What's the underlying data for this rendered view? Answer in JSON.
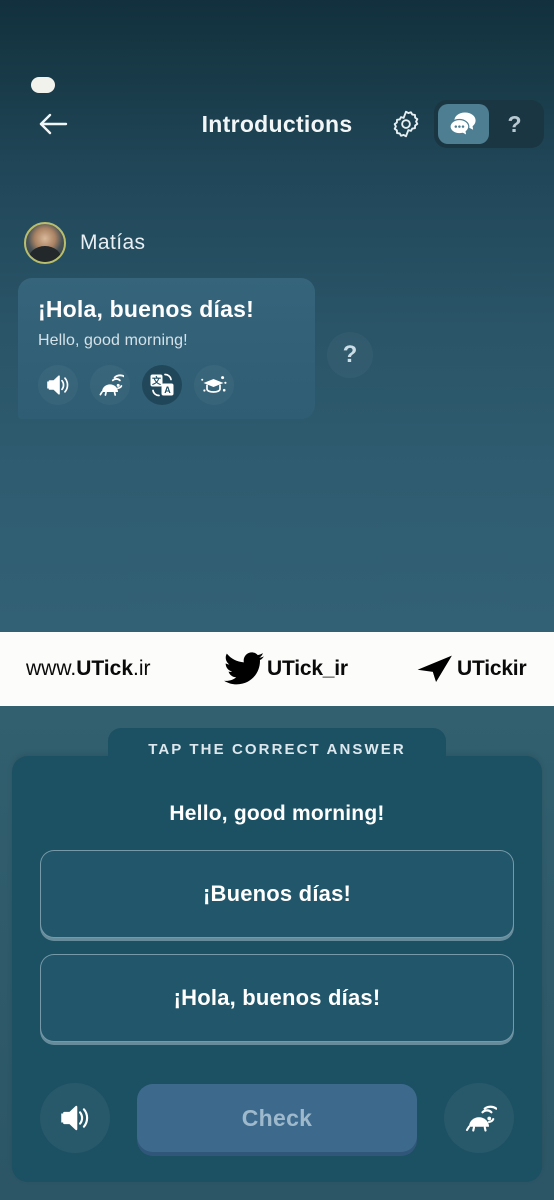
{
  "header": {
    "title": "Introductions",
    "back_icon": "back-arrow-icon",
    "gear_icon": "gear-icon",
    "toggle": {
      "chat_icon": "chat-bubbles-icon",
      "chat_active": true,
      "help_label": "?"
    }
  },
  "status_bar": {
    "pill": "status-pill"
  },
  "conversation": {
    "speaker": {
      "name": "Matías",
      "avatar_ring_color": "#B9BE6C"
    },
    "message": {
      "primary_text": "¡Hola, buenos días!",
      "translation_text": "Hello, good morning!",
      "icons": [
        {
          "name": "speaker-icon",
          "label": "Play audio",
          "highlighted": false
        },
        {
          "name": "turtle-slow-icon",
          "label": "Play slowly",
          "highlighted": false
        },
        {
          "name": "translate-icon",
          "label": "Translate",
          "highlighted": true
        },
        {
          "name": "graduation-cap-icon",
          "label": "Explain grammar",
          "highlighted": false
        }
      ]
    },
    "hint_button_label": "?"
  },
  "watermark": {
    "site_prefix": "www.",
    "site_bold": "UTick",
    "site_suffix": ".ir",
    "twitter_icon": "twitter-bird-icon",
    "twitter_handle": "UTick_ir",
    "telegram_icon": "telegram-plane-icon",
    "telegram_handle": "UTickir"
  },
  "exercise": {
    "instruction": "TAP THE CORRECT ANSWER",
    "prompt": "Hello, good morning!",
    "options": [
      {
        "text": "¡Buenos días!",
        "selected": false
      },
      {
        "text": "¡Hola, buenos días!",
        "selected": false
      }
    ],
    "actions": {
      "speaker_icon": "speaker-icon",
      "check_label": "Check",
      "check_disabled": true,
      "turtle_icon": "turtle-slow-icon"
    }
  },
  "colors": {
    "background_top": "#12303D",
    "background_mid": "#2E5C70",
    "bubble": "#35647B",
    "card": "#1C5063",
    "check_button": "#3D6A8C",
    "accent_toggle": "#4E7E92",
    "watermark_band": "#FCFCFA"
  }
}
